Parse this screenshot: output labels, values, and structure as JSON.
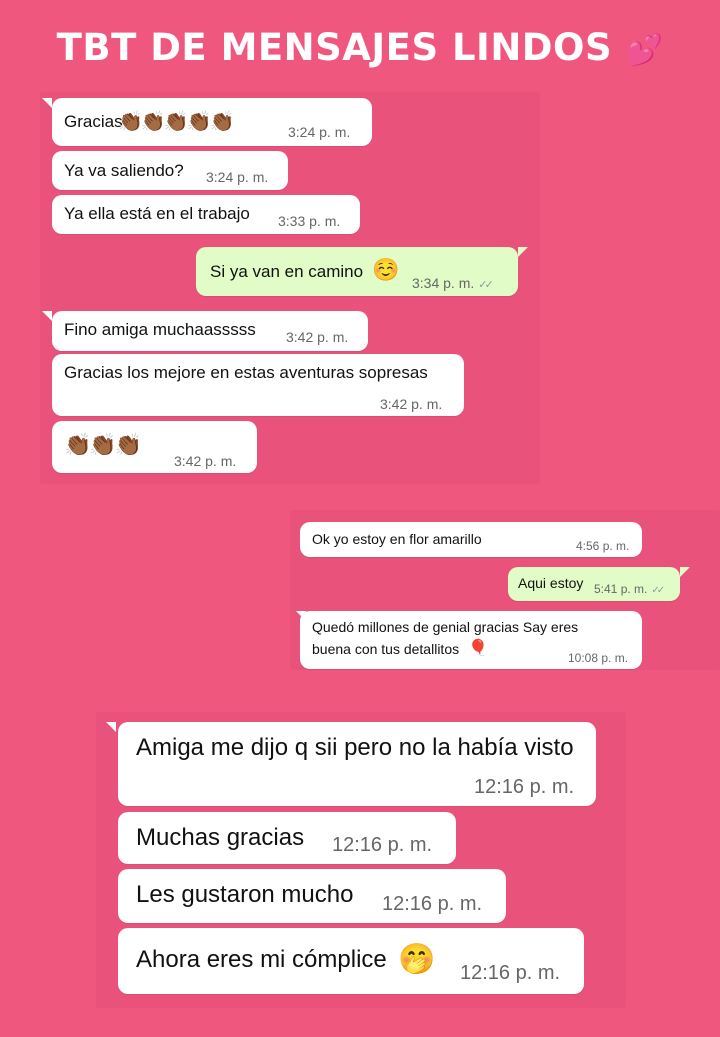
{
  "title": {
    "text": "TBT DE MENSAJES LINDOS",
    "emoji": "💕"
  },
  "section1": {
    "messages": [
      {
        "text": "Gracias",
        "emoji": "👏🏾👏🏾👏🏾👏🏾👏🏾",
        "time": "3:24 p. m.",
        "direction": "incoming"
      },
      {
        "text": "Ya va saliendo?",
        "time": "3:24 p. m.",
        "direction": "incoming"
      },
      {
        "text": "Ya ella está en el trabajo",
        "time": "3:33 p. m.",
        "direction": "incoming"
      },
      {
        "text": "Si ya van en camino",
        "emoji": "☺️",
        "time": "3:34 p. m.",
        "direction": "outgoing",
        "read": true
      },
      {
        "text": "Fino amiga muchaasssss",
        "time": "3:42 p. m.",
        "direction": "incoming"
      },
      {
        "text": "Gracias los mejore en estas aventuras sopresas",
        "time": "3:42 p. m.",
        "direction": "incoming"
      },
      {
        "text": "",
        "emoji": "👏🏾👏🏾👏🏾",
        "time": "3:42 p. m.",
        "direction": "incoming"
      }
    ]
  },
  "section2": {
    "messages": [
      {
        "text": "Ok yo estoy en flor amarillo",
        "time": "4:56 p. m.",
        "direction": "outgoing"
      },
      {
        "text": "Aqui estoy",
        "time": "5:41 p. m.",
        "direction": "outgoing",
        "read": true
      },
      {
        "text_line1": "Quedó millones de genial gracias Say eres",
        "text_line2": "buena con tus detallitos",
        "emoji": "🎈",
        "time": "10:08 p. m.",
        "direction": "outgoing"
      }
    ]
  },
  "section3": {
    "messages": [
      {
        "text": "Amiga me dijo q sii pero no la había visto",
        "time": "12:16 p. m.",
        "direction": "incoming"
      },
      {
        "text": "Muchas gracias",
        "time": "12:16 p. m.",
        "direction": "incoming"
      },
      {
        "text": "Les gustaron mucho",
        "time": "12:16 p. m.",
        "direction": "incoming"
      },
      {
        "text": "Ahora eres mi cómplice",
        "emoji": "🤭",
        "time": "12:16 p. m.",
        "direction": "incoming"
      }
    ]
  },
  "colors": {
    "background": "#f0577f",
    "incoming_bubble": "#ffffff",
    "outgoing_bubble": "#e2fcc8",
    "timestamp": "#666666"
  }
}
